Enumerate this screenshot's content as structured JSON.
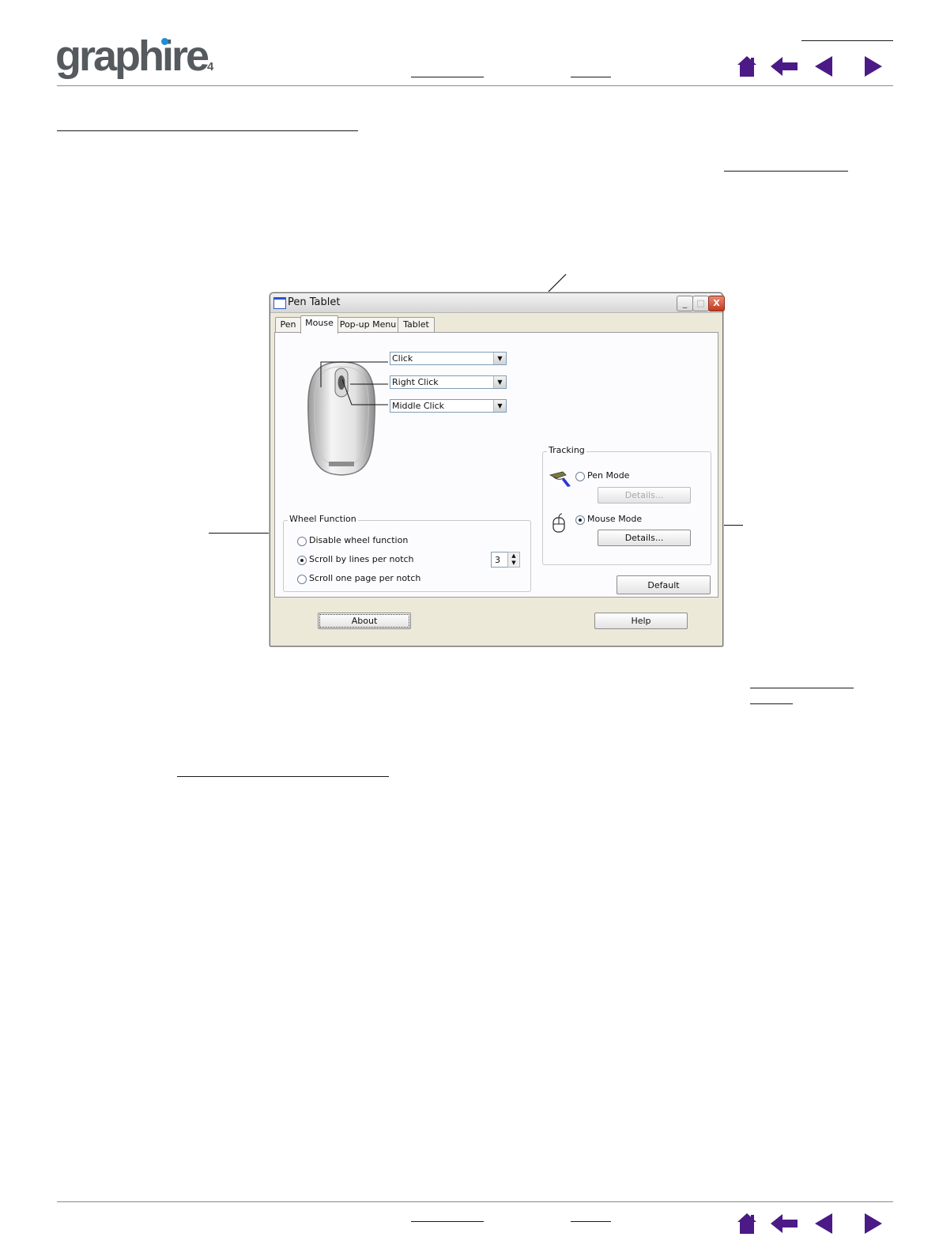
{
  "header": {
    "logo_text": "graphire",
    "logo_superscript": "4"
  },
  "nav": {
    "home": "home-icon",
    "back": "back-arrow-icon",
    "previous": "previous-page-icon",
    "next": "next-page-icon"
  },
  "dialog": {
    "title": "Pen Tablet",
    "window_buttons": {
      "minimize": "_",
      "maximize": "□",
      "close": "X"
    },
    "tabs": [
      {
        "label": "Pen"
      },
      {
        "label": "Mouse"
      },
      {
        "label": "Pop-up Menu"
      },
      {
        "label": "Tablet"
      }
    ],
    "button_functions": [
      {
        "value": "Click"
      },
      {
        "value": "Right Click"
      },
      {
        "value": "Middle Click"
      }
    ],
    "wheel": {
      "title": "Wheel Function",
      "options": [
        {
          "label": "Disable wheel function",
          "selected": false
        },
        {
          "label": "Scroll by lines per notch",
          "selected": true
        },
        {
          "label": "Scroll one page per notch",
          "selected": false
        }
      ],
      "lines_value": "3"
    },
    "tracking": {
      "title": "Tracking",
      "pen_mode": {
        "label": "Pen Mode",
        "selected": false,
        "details_label": "Details..."
      },
      "mouse_mode": {
        "label": "Mouse Mode",
        "selected": true,
        "details_label": "Details..."
      }
    },
    "default_label": "Default",
    "about_label": "About",
    "help_label": "Help"
  }
}
